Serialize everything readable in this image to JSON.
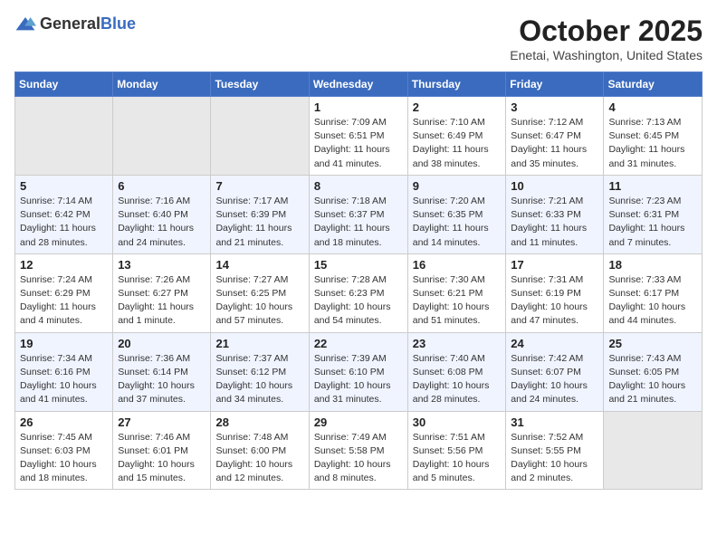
{
  "header": {
    "logo_general": "General",
    "logo_blue": "Blue",
    "month_title": "October 2025",
    "location": "Enetai, Washington, United States"
  },
  "days_of_week": [
    "Sunday",
    "Monday",
    "Tuesday",
    "Wednesday",
    "Thursday",
    "Friday",
    "Saturday"
  ],
  "weeks": [
    [
      {
        "day": "",
        "empty": true
      },
      {
        "day": "",
        "empty": true
      },
      {
        "day": "",
        "empty": true
      },
      {
        "day": "1",
        "sunrise": "7:09 AM",
        "sunset": "6:51 PM",
        "daylight": "11 hours and 41 minutes."
      },
      {
        "day": "2",
        "sunrise": "7:10 AM",
        "sunset": "6:49 PM",
        "daylight": "11 hours and 38 minutes."
      },
      {
        "day": "3",
        "sunrise": "7:12 AM",
        "sunset": "6:47 PM",
        "daylight": "11 hours and 35 minutes."
      },
      {
        "day": "4",
        "sunrise": "7:13 AM",
        "sunset": "6:45 PM",
        "daylight": "11 hours and 31 minutes."
      }
    ],
    [
      {
        "day": "5",
        "sunrise": "7:14 AM",
        "sunset": "6:42 PM",
        "daylight": "11 hours and 28 minutes."
      },
      {
        "day": "6",
        "sunrise": "7:16 AM",
        "sunset": "6:40 PM",
        "daylight": "11 hours and 24 minutes."
      },
      {
        "day": "7",
        "sunrise": "7:17 AM",
        "sunset": "6:39 PM",
        "daylight": "11 hours and 21 minutes."
      },
      {
        "day": "8",
        "sunrise": "7:18 AM",
        "sunset": "6:37 PM",
        "daylight": "11 hours and 18 minutes."
      },
      {
        "day": "9",
        "sunrise": "7:20 AM",
        "sunset": "6:35 PM",
        "daylight": "11 hours and 14 minutes."
      },
      {
        "day": "10",
        "sunrise": "7:21 AM",
        "sunset": "6:33 PM",
        "daylight": "11 hours and 11 minutes."
      },
      {
        "day": "11",
        "sunrise": "7:23 AM",
        "sunset": "6:31 PM",
        "daylight": "11 hours and 7 minutes."
      }
    ],
    [
      {
        "day": "12",
        "sunrise": "7:24 AM",
        "sunset": "6:29 PM",
        "daylight": "11 hours and 4 minutes."
      },
      {
        "day": "13",
        "sunrise": "7:26 AM",
        "sunset": "6:27 PM",
        "daylight": "11 hours and 1 minute."
      },
      {
        "day": "14",
        "sunrise": "7:27 AM",
        "sunset": "6:25 PM",
        "daylight": "10 hours and 57 minutes."
      },
      {
        "day": "15",
        "sunrise": "7:28 AM",
        "sunset": "6:23 PM",
        "daylight": "10 hours and 54 minutes."
      },
      {
        "day": "16",
        "sunrise": "7:30 AM",
        "sunset": "6:21 PM",
        "daylight": "10 hours and 51 minutes."
      },
      {
        "day": "17",
        "sunrise": "7:31 AM",
        "sunset": "6:19 PM",
        "daylight": "10 hours and 47 minutes."
      },
      {
        "day": "18",
        "sunrise": "7:33 AM",
        "sunset": "6:17 PM",
        "daylight": "10 hours and 44 minutes."
      }
    ],
    [
      {
        "day": "19",
        "sunrise": "7:34 AM",
        "sunset": "6:16 PM",
        "daylight": "10 hours and 41 minutes."
      },
      {
        "day": "20",
        "sunrise": "7:36 AM",
        "sunset": "6:14 PM",
        "daylight": "10 hours and 37 minutes."
      },
      {
        "day": "21",
        "sunrise": "7:37 AM",
        "sunset": "6:12 PM",
        "daylight": "10 hours and 34 minutes."
      },
      {
        "day": "22",
        "sunrise": "7:39 AM",
        "sunset": "6:10 PM",
        "daylight": "10 hours and 31 minutes."
      },
      {
        "day": "23",
        "sunrise": "7:40 AM",
        "sunset": "6:08 PM",
        "daylight": "10 hours and 28 minutes."
      },
      {
        "day": "24",
        "sunrise": "7:42 AM",
        "sunset": "6:07 PM",
        "daylight": "10 hours and 24 minutes."
      },
      {
        "day": "25",
        "sunrise": "7:43 AM",
        "sunset": "6:05 PM",
        "daylight": "10 hours and 21 minutes."
      }
    ],
    [
      {
        "day": "26",
        "sunrise": "7:45 AM",
        "sunset": "6:03 PM",
        "daylight": "10 hours and 18 minutes."
      },
      {
        "day": "27",
        "sunrise": "7:46 AM",
        "sunset": "6:01 PM",
        "daylight": "10 hours and 15 minutes."
      },
      {
        "day": "28",
        "sunrise": "7:48 AM",
        "sunset": "6:00 PM",
        "daylight": "10 hours and 12 minutes."
      },
      {
        "day": "29",
        "sunrise": "7:49 AM",
        "sunset": "5:58 PM",
        "daylight": "10 hours and 8 minutes."
      },
      {
        "day": "30",
        "sunrise": "7:51 AM",
        "sunset": "5:56 PM",
        "daylight": "10 hours and 5 minutes."
      },
      {
        "day": "31",
        "sunrise": "7:52 AM",
        "sunset": "5:55 PM",
        "daylight": "10 hours and 2 minutes."
      },
      {
        "day": "",
        "empty": true
      }
    ]
  ]
}
